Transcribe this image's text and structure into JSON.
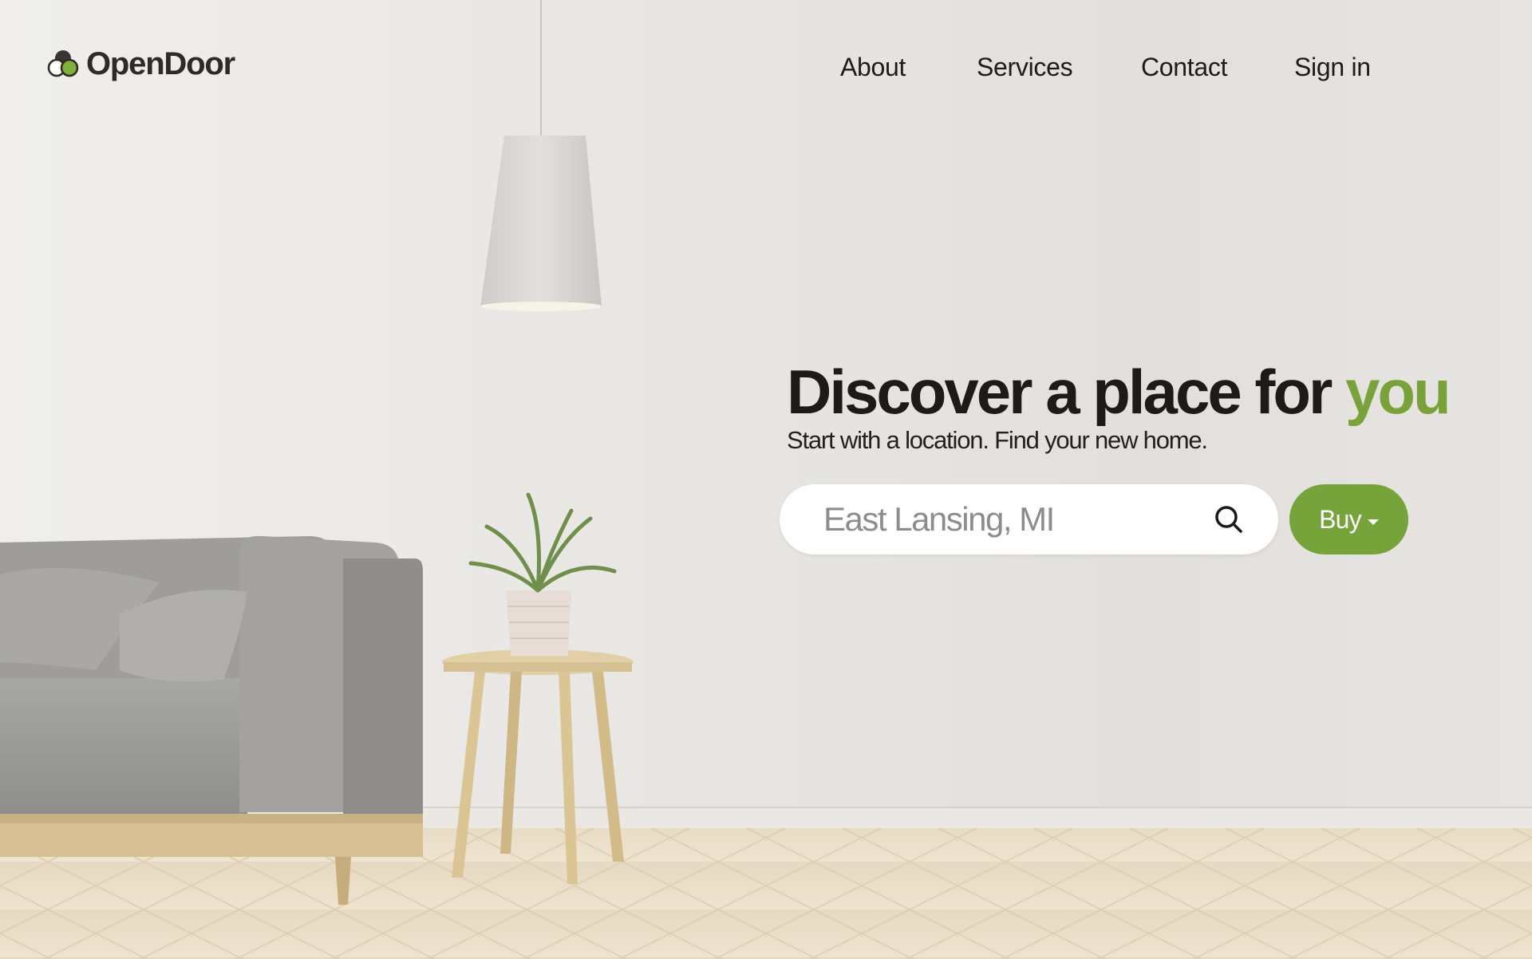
{
  "header": {
    "logo_text": "OpenDoor",
    "nav": [
      {
        "label": "About"
      },
      {
        "label": "Services"
      },
      {
        "label": "Contact"
      },
      {
        "label": "Sign in"
      }
    ]
  },
  "hero": {
    "title_main": "Discover a place for ",
    "title_accent": "you",
    "subtitle": "Start with a location. Find your new home.",
    "search": {
      "placeholder": "East Lansing, MI",
      "icon": "search-icon"
    },
    "mode_button": {
      "label": "Buy",
      "icon": "caret-down-icon"
    }
  },
  "colors": {
    "accent": "#79a33a",
    "button_bg": "#76a33a",
    "text_dark": "#1d1a18",
    "logo_text": "#2f2a26"
  }
}
